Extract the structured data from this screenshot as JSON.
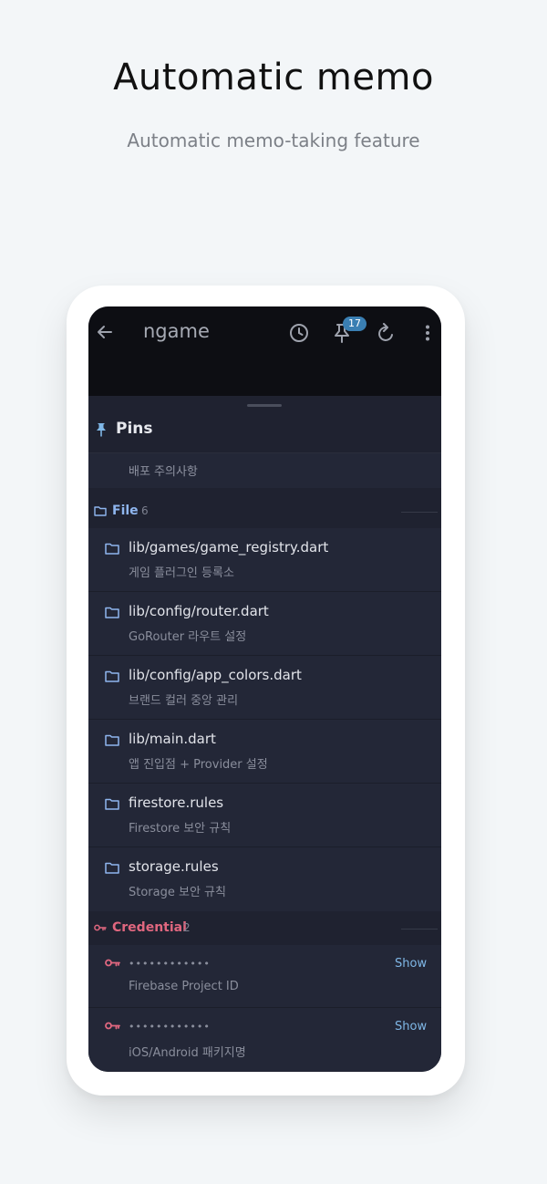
{
  "promo": {
    "headline": "Automatic memo",
    "subline": "Automatic memo-taking feature"
  },
  "appbar": {
    "title": "ngame",
    "pin_badge": "17"
  },
  "pins": {
    "title": "Pins",
    "item": "배포 주의사항"
  },
  "file_section": {
    "label": "File",
    "count": "6",
    "items": [
      {
        "path": "lib/games/game_registry.dart",
        "desc": "게임 플러그인 등록소"
      },
      {
        "path": "lib/config/router.dart",
        "desc": "GoRouter 라우트 설정"
      },
      {
        "path": "lib/config/app_colors.dart",
        "desc": "브랜드 컬러 중앙 관리"
      },
      {
        "path": "lib/main.dart",
        "desc": "앱 진입점 + Provider 설정"
      },
      {
        "path": "firestore.rules",
        "desc": "Firestore 보안 규칙"
      },
      {
        "path": "storage.rules",
        "desc": "Storage 보안 규칙"
      }
    ]
  },
  "credential_section": {
    "label": "Credential",
    "count": "2",
    "items": [
      {
        "masked": "••••••••••••",
        "desc": "Firebase Project ID",
        "action": "Show"
      },
      {
        "masked": "••••••••••••",
        "desc": "iOS/Android 패키지명",
        "action": "Show"
      }
    ]
  },
  "colors": {
    "file_accent": "#8fb6ef",
    "credential_accent": "#e0677f",
    "badge": "#3a7fb3",
    "show_link": "#7fb7e6"
  },
  "icons": [
    "back-arrow-icon",
    "history-icon",
    "pin-icon",
    "refresh-icon",
    "more-vert-icon",
    "folder-icon",
    "key-icon"
  ]
}
